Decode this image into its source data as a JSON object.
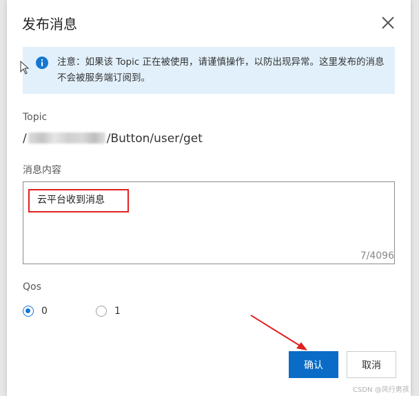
{
  "dialog": {
    "title": "发布消息",
    "close_icon": "close-icon"
  },
  "notice": {
    "icon": "info-icon",
    "text": "注意：如果该 Topic 正在被使用，请谨慎操作，以防出现异常。这里发布的消息不会被服务端订阅到。"
  },
  "topic": {
    "label": "Topic",
    "prefix": "/",
    "suffix": "/Button/user/get"
  },
  "message": {
    "label": "消息内容",
    "value": "云平台收到消息",
    "counter": "7/4096"
  },
  "qos": {
    "label": "Qos",
    "options": [
      {
        "label": "0",
        "checked": true
      },
      {
        "label": "1",
        "checked": false
      }
    ]
  },
  "buttons": {
    "confirm": "确认",
    "cancel": "取消"
  },
  "watermark": "CSDN @风行男孩",
  "colors": {
    "primary": "#0a6cc7",
    "notice_bg": "#e2f0fb",
    "annotation_red": "#e02020"
  }
}
